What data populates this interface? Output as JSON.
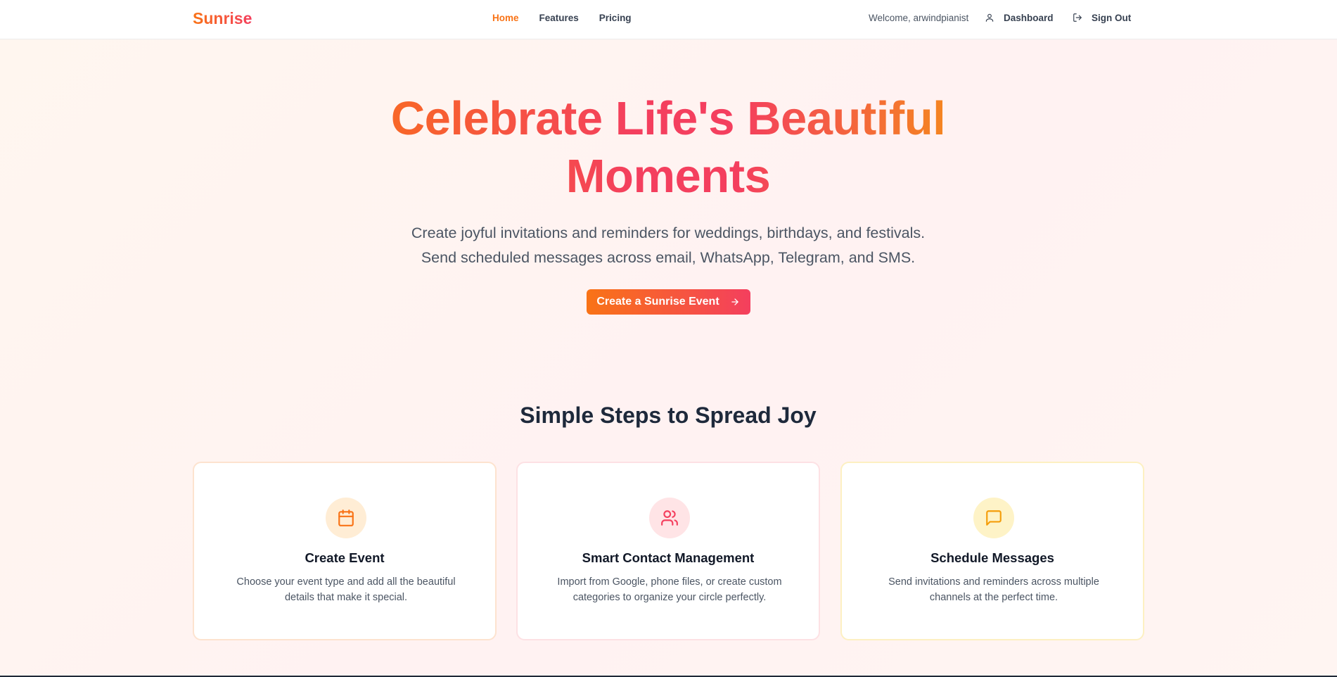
{
  "header": {
    "brand": "Sunrise",
    "nav": [
      {
        "label": "Home",
        "active": true
      },
      {
        "label": "Features",
        "active": false
      },
      {
        "label": "Pricing",
        "active": false
      }
    ],
    "welcome": "Welcome, arwindpianist",
    "dashboard_label": "Dashboard",
    "signout_label": "Sign Out"
  },
  "hero": {
    "title_line1": "Celebrate Life's Beautiful",
    "title_line2": "Moments",
    "subtitle_line1": "Create joyful invitations and reminders for weddings, birthdays, and festivals.",
    "subtitle_line2": "Send scheduled messages across email, WhatsApp, Telegram, and SMS.",
    "cta_label": "Create a Sunrise Event"
  },
  "steps": {
    "title": "Simple Steps to Spread Joy",
    "cards": [
      {
        "icon": "calendar-icon",
        "title": "Create Event",
        "desc": "Choose your event type and add all the beautiful details that make it special."
      },
      {
        "icon": "users-icon",
        "title": "Smart Contact Management",
        "desc": "Import from Google, phone files, or create custom categories to organize your circle perfectly."
      },
      {
        "icon": "message-square-icon",
        "title": "Schedule Messages",
        "desc": "Send invitations and reminders across multiple channels at the perfect time."
      }
    ]
  },
  "colors": {
    "accent_orange": "#f97316",
    "accent_rose": "#f43f5e",
    "accent_amber": "#f59e0b"
  }
}
